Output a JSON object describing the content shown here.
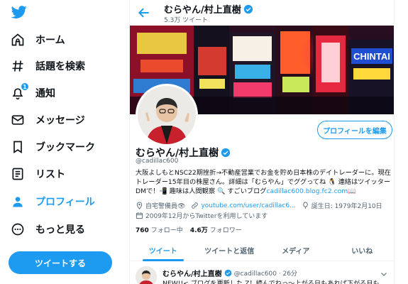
{
  "sidebar": {
    "items": [
      {
        "label": "ホーム",
        "icon": "home-icon"
      },
      {
        "label": "話題を検索",
        "icon": "hashtag-icon"
      },
      {
        "label": "通知",
        "icon": "bell-icon",
        "badge": "1"
      },
      {
        "label": "メッセージ",
        "icon": "mail-icon"
      },
      {
        "label": "ブックマーク",
        "icon": "bookmark-icon"
      },
      {
        "label": "リスト",
        "icon": "list-icon"
      },
      {
        "label": "プロフィール",
        "icon": "person-icon",
        "active": true
      },
      {
        "label": "もっと見る",
        "icon": "more-circle-icon"
      }
    ],
    "tweet_button": "ツイートする"
  },
  "header": {
    "name": "むらやん/村上直樹",
    "tweet_count": "5.3万 ツイート"
  },
  "profile": {
    "edit_button": "プロフィールを編集",
    "display_name": "むらやん/村上直樹",
    "handle": "@cadillac600",
    "bio_text": "大阪よしもとNSC22期挫折→不動産営業でお金を貯め日本株のデイトレーダーに。現在トレーダー15年目の株屋さん。詳細は「むらやん」でググってね 🐧 連絡はツイッターDMで！📲 趣味は人間観察 🔍 すごいブログ",
    "bio_link": "cadillac600.blog.fc2.com📖",
    "occupation": "自宅警備員👁",
    "website": "youtube.com/user/cadillac6...",
    "birthday": "誕生日: 1979年2月10日",
    "joined": "2009年12月からTwitterを利用しています",
    "following_count": "760",
    "following_label": "フォロー中",
    "followers_count": "4.6万",
    "followers_label": "フォロワー"
  },
  "tabs": [
    {
      "label": "ツイート",
      "active": true
    },
    {
      "label": "ツイートと返信"
    },
    {
      "label": "メディア"
    },
    {
      "label": "いいね"
    }
  ],
  "tweet": {
    "name": "むらやん/村上直樹",
    "handle_time": "@cadillac600 · 26分",
    "text": "NEW!!< ブログを更新した Z！読んでねっ～上がる日もあれば下がる日も"
  },
  "colors": {
    "accent": "#1d9bf0",
    "text": "#0f1419",
    "secondary": "#536471"
  }
}
